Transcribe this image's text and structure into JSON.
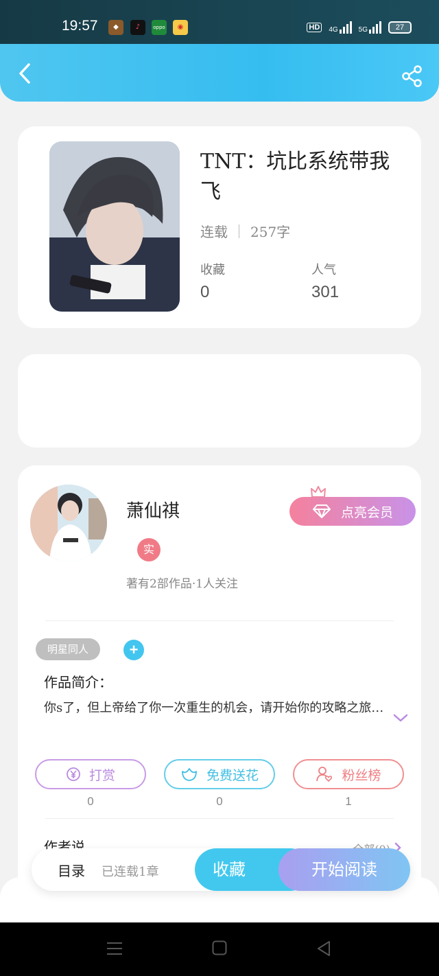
{
  "status_bar": {
    "time": "19:57",
    "battery": "27",
    "network": "4G",
    "network2": "5G",
    "hd": "HD"
  },
  "colors": {
    "accent": "#42c6ef",
    "header": "#3bbff0",
    "vip_start": "#f4819d",
    "vip_end": "#c992e8"
  },
  "header": {
    "back_icon": "chevron-left-icon",
    "share_icon": "share-icon"
  },
  "book": {
    "title": "TNT：坑比系统带我飞",
    "status": "连载",
    "word_count": "257字",
    "favorites_label": "收藏",
    "favorites_value": "0",
    "popularity_label": "人气",
    "popularity_value": "301"
  },
  "author": {
    "name": "萧仙祺",
    "verified_badge": "实",
    "meta": "著有2部作品·1人关注",
    "vip_button": "点亮会员"
  },
  "tags": {
    "tag1": "明星同人",
    "add_label": "+"
  },
  "intro": {
    "label": "作品简介：",
    "text": "你s了，但上帝给了你一次重生的机会，请开始你的攻略之旅…"
  },
  "actions": {
    "tip": {
      "label": "打赏",
      "count": "0"
    },
    "flower": {
      "label": "免费送花",
      "count": "0"
    },
    "fans": {
      "label": "粉丝榜",
      "count": "1"
    }
  },
  "author_says": {
    "label": "作者说",
    "all_link": "全部(0)"
  },
  "bottom_bar": {
    "catalog": "目录",
    "chapters": "已连载1章",
    "favorite": "收藏",
    "start_reading": "开始阅读"
  }
}
